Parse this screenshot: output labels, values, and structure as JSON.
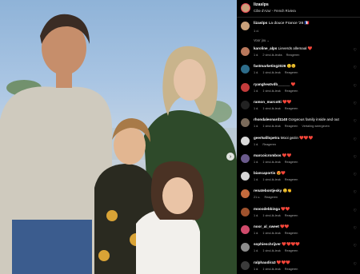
{
  "post": {
    "author": "lizaslps",
    "location": "Côte d'Azur - French Riviera",
    "caption_user": "lizaslps",
    "caption_text": "La douce France '26 🇫🇷",
    "caption_meta": "1 d.",
    "translate_label": "Voor jou ⌄"
  },
  "colors": {
    "accent": "#ed4956",
    "muted": "#a8a8a8",
    "panel_bg": "#000000"
  },
  "comments": [
    {
      "user": "karoline_alps",
      "text": "Lieverds allemaal ❤️",
      "time": "1 d.",
      "likes": "2 vind-ik-leuks",
      "reply": "Reageren",
      "avatar": "#b9785c",
      "extra": ""
    },
    {
      "user": "fastmarketing2026",
      "text": "🙂😊",
      "time": "1 d.",
      "likes": "1 vind-ik-leuk",
      "reply": "Reageren",
      "avatar": "#2d6c8a",
      "extra": ""
    },
    {
      "user": "ryangheatvdb______",
      "text": "❤️",
      "time": "1 d.",
      "likes": "1 vind-ik-leuk",
      "reply": "Reageren",
      "avatar": "#c23b3b",
      "extra": ""
    },
    {
      "user": "ramon_marcotti",
      "text": "❤️❤️",
      "time": "1 d.",
      "likes": "1 vind-ik-leuk",
      "reply": "Reageren",
      "avatar": "#222222",
      "extra": ""
    },
    {
      "user": "rhondaleonard1140",
      "text": "Gorgeous family inside and out",
      "time": "1 d.",
      "likes": "1 vind-ik-leuk",
      "reply": "Reageren",
      "avatar": "#7a6a5a",
      "extra": "Vertaling weergeven"
    },
    {
      "user": "geertwillspetra",
      "text": "Mooi gezin ❤️❤️❤️",
      "time": "1 d.",
      "likes": "",
      "reply": "Reageren",
      "avatar": "#d9d9d9",
      "extra": ""
    },
    {
      "user": "marcoicrombos",
      "text": "❤️❤️",
      "time": "1 d.",
      "likes": "1 vind-ik-leuk",
      "reply": "Reageren",
      "avatar": "#6a5a8c",
      "extra": ""
    },
    {
      "user": "biancaportis",
      "text": "😍❤️",
      "time": "1 d.",
      "likes": "1 vind-ik-leuk",
      "reply": "Reageren",
      "avatar": "#d6d6d6",
      "extra": ""
    },
    {
      "user": "renatebontjesky",
      "text": "😊👏",
      "time": "21 u.",
      "likes": "",
      "reply": "Reageren",
      "avatar": "#c46b3d",
      "extra": ""
    },
    {
      "user": "mooodebbinga",
      "text": "❤️❤️",
      "time": "1 d.",
      "likes": "1 vind-ik-leuk",
      "reply": "Reageren",
      "avatar": "#a0522d",
      "extra": ""
    },
    {
      "user": "noor_al_sweet",
      "text": "❤️❤️",
      "time": "1 d.",
      "likes": "1 vind-ik-leuk",
      "reply": "Reageren",
      "avatar": "#d04a6b",
      "extra": ""
    },
    {
      "user": "sophieschrijver",
      "text": "❤️❤️❤️❤️",
      "time": "1 d.",
      "likes": "1 vind-ik-leuk",
      "reply": "Reageren",
      "avatar": "#8b8b8b",
      "extra": ""
    },
    {
      "user": "ralphaudira3",
      "text": "❤️❤️❤️",
      "time": "1 d.",
      "likes": "1 vind-ik-leuk",
      "reply": "Reageren",
      "avatar": "#3a3a3a",
      "extra": ""
    }
  ]
}
